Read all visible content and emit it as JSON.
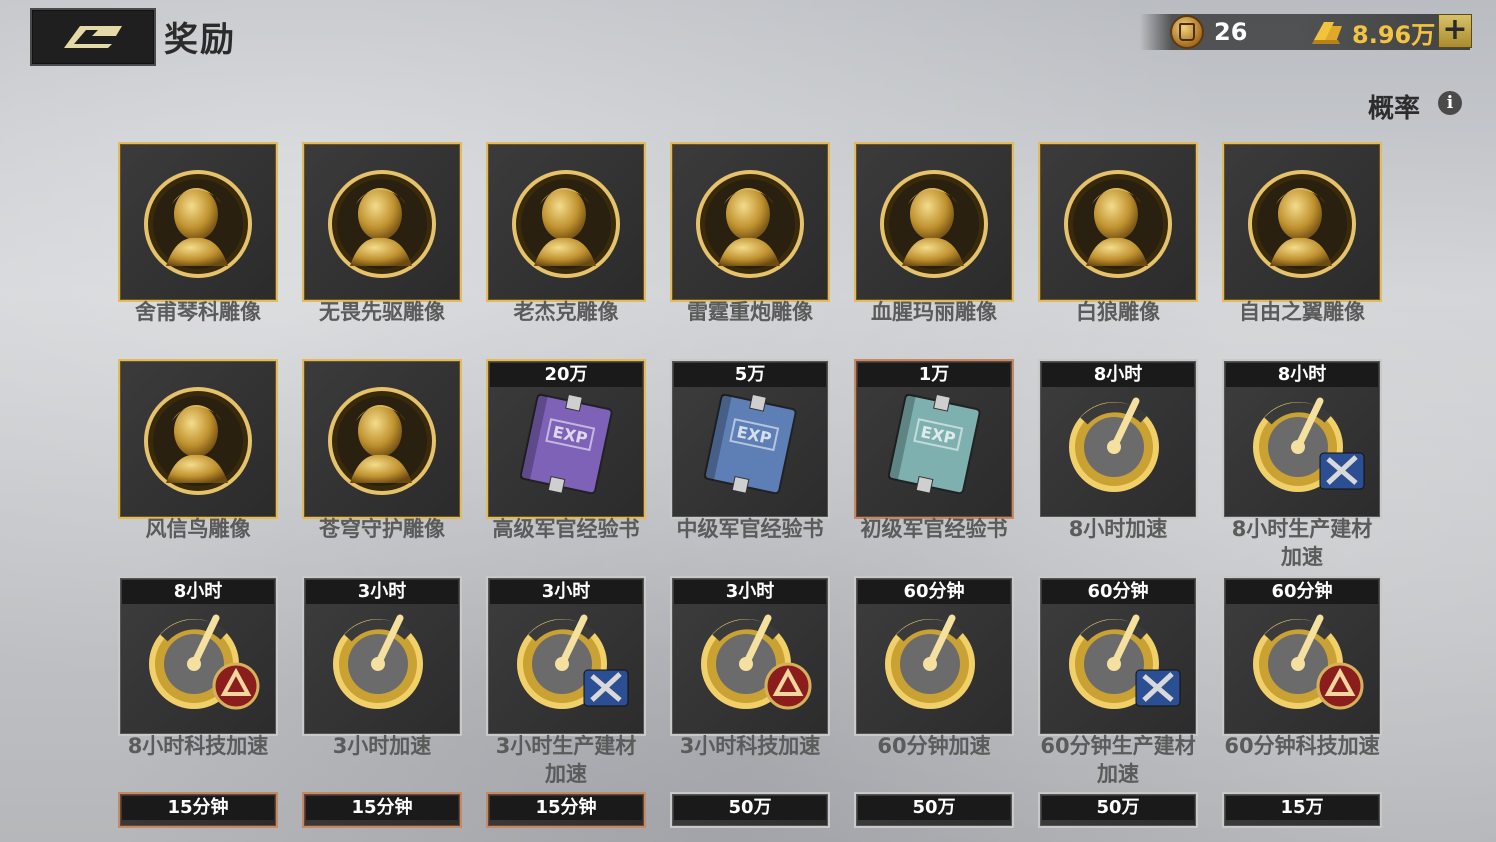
{
  "header": {
    "title": "奖励"
  },
  "currency": {
    "coin_value": "26",
    "gold_value": "8.96万",
    "add_label": "+"
  },
  "probability": {
    "label": "概率",
    "info_glyph": "i"
  },
  "colors": {
    "gold_border": "#d9b45b",
    "silver_border": "#c9c9c9",
    "copper_border": "#c48a68",
    "gold_text": "#f3c441"
  },
  "rewards": [
    {
      "name": "舍甫琴科雕像",
      "tag": "",
      "icon": "portrait-bust-icon",
      "frame": "gold"
    },
    {
      "name": "无畏先驱雕像",
      "tag": "",
      "icon": "portrait-bust-icon",
      "frame": "gold"
    },
    {
      "name": "老杰克雕像",
      "tag": "",
      "icon": "portrait-bust-icon",
      "frame": "gold"
    },
    {
      "name": "雷霆重炮雕像",
      "tag": "",
      "icon": "portrait-bust-icon",
      "frame": "gold"
    },
    {
      "name": "血腥玛丽雕像",
      "tag": "",
      "icon": "portrait-bust-icon",
      "frame": "gold"
    },
    {
      "name": "白狼雕像",
      "tag": "",
      "icon": "portrait-bust-icon",
      "frame": "gold"
    },
    {
      "name": "自由之翼雕像",
      "tag": "",
      "icon": "portrait-bust-icon",
      "frame": "gold"
    },
    {
      "name": "风信鸟雕像",
      "tag": "",
      "icon": "portrait-bust-icon",
      "frame": "gold"
    },
    {
      "name": "苍穹守护雕像",
      "tag": "",
      "icon": "portrait-bust-icon",
      "frame": "gold"
    },
    {
      "name": "高级军官经验书",
      "tag": "20万",
      "icon": "exp-book-purple-icon",
      "frame": "gold"
    },
    {
      "name": "中级军官经验书",
      "tag": "5万",
      "icon": "exp-book-blue-icon",
      "frame": "silver"
    },
    {
      "name": "初级军官经验书",
      "tag": "1万",
      "icon": "exp-book-teal-icon",
      "frame": "copper"
    },
    {
      "name": "8小时加速",
      "tag": "8小时",
      "icon": "speedup-clock-icon",
      "frame": "silver"
    },
    {
      "name": "8小时生产建材加速",
      "tag": "8小时",
      "icon": "speedup-build-icon",
      "frame": "silver"
    },
    {
      "name": "8小时科技加速",
      "tag": "8小时",
      "icon": "speedup-tech-icon",
      "frame": "silver"
    },
    {
      "name": "3小时加速",
      "tag": "3小时",
      "icon": "speedup-clock-icon",
      "frame": "silver"
    },
    {
      "name": "3小时生产建材加速",
      "tag": "3小时",
      "icon": "speedup-build-icon",
      "frame": "silver"
    },
    {
      "name": "3小时科技加速",
      "tag": "3小时",
      "icon": "speedup-tech-icon",
      "frame": "silver"
    },
    {
      "name": "60分钟加速",
      "tag": "60分钟",
      "icon": "speedup-clock-icon",
      "frame": "silver"
    },
    {
      "name": "60分钟生产建材加速",
      "tag": "60分钟",
      "icon": "speedup-build-icon",
      "frame": "silver"
    },
    {
      "name": "60分钟科技加速",
      "tag": "60分钟",
      "icon": "speedup-tech-icon",
      "frame": "silver"
    },
    {
      "name": "",
      "tag": "15分钟",
      "icon": "",
      "frame": "copper"
    },
    {
      "name": "",
      "tag": "15分钟",
      "icon": "",
      "frame": "copper"
    },
    {
      "name": "",
      "tag": "15分钟",
      "icon": "",
      "frame": "copper"
    },
    {
      "name": "",
      "tag": "50万",
      "icon": "",
      "frame": "silver"
    },
    {
      "name": "",
      "tag": "50万",
      "icon": "",
      "frame": "silver"
    },
    {
      "name": "",
      "tag": "50万",
      "icon": "",
      "frame": "silver"
    },
    {
      "name": "",
      "tag": "15万",
      "icon": "",
      "frame": "silver"
    }
  ]
}
